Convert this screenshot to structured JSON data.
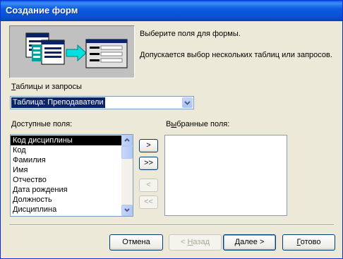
{
  "window": {
    "title": "Создание форм"
  },
  "intro": {
    "line1": "Выберите поля для формы.",
    "line2": "Допускается выбор нескольких таблиц или запросов."
  },
  "source": {
    "label_u": "Т",
    "label_rest": "аблицы и запросы",
    "selected": "Таблица: Преподаватели"
  },
  "available": {
    "label_u": "Д",
    "label_rest": "оступные поля:",
    "items": [
      "Код дисциплины",
      "Код",
      "Фамилия",
      "Имя",
      "Отчество",
      "Дата рождения",
      "Должность",
      "Дисциплина"
    ],
    "selected_index": 0
  },
  "selected_fields": {
    "label_pre": "В",
    "label_u": "ы",
    "label_rest": "бранные поля:"
  },
  "move_buttons": {
    "add": ">",
    "add_all": ">>",
    "remove": "<",
    "remove_all": "<<"
  },
  "footer": {
    "cancel": "Отмена",
    "back_pre": "< ",
    "back_u": "Н",
    "back_rest": "азад",
    "next_u": "Д",
    "next_rest": "алее >",
    "finish_u": "Г",
    "finish_rest": "отово"
  },
  "colors": {
    "titlebar": "#0A52D6",
    "selection": "#0A246A",
    "dialog_bg": "#ECE9D8"
  }
}
